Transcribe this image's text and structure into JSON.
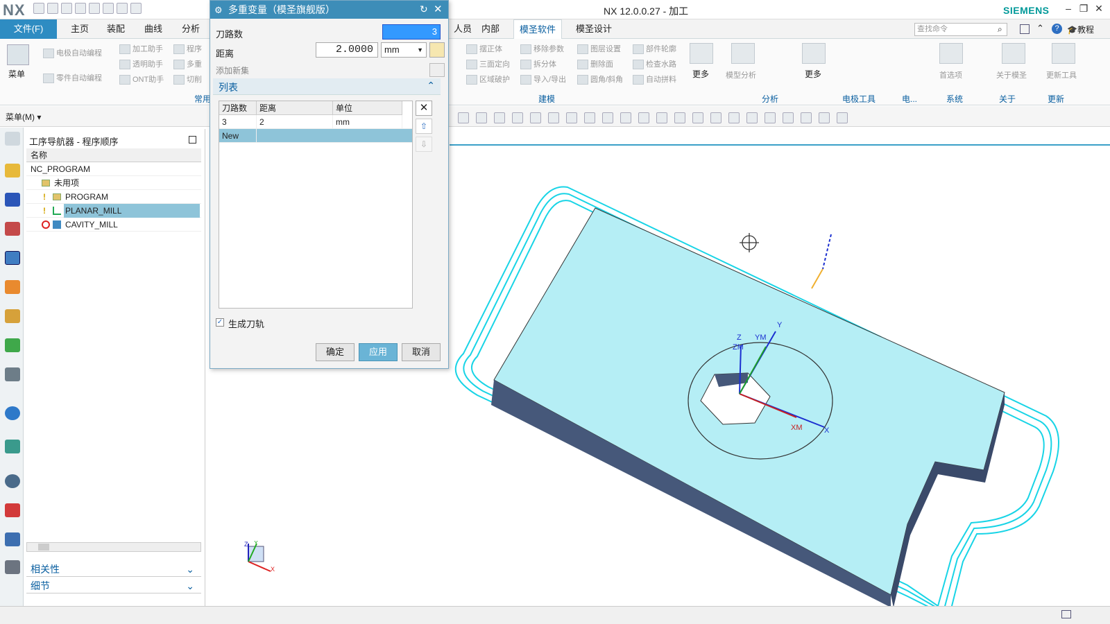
{
  "app": {
    "logo": "NX",
    "window_title": "NX 12.0.0.27 - 加工",
    "brand": "SIEMENS"
  },
  "ribbon": {
    "file_tab": "文件(F)",
    "tabs": [
      "主页",
      "装配",
      "曲线",
      "分析"
    ],
    "tabs_right": [
      "人员",
      "内部",
      "模圣软件",
      "模圣设计"
    ],
    "active_tab": "模圣软件",
    "search_placeholder": "查找命令",
    "tutorial": "教程",
    "menu_button": "菜单",
    "left_items": [
      "电极自动编程",
      "零件自动编程",
      "加工助手",
      "透明助手",
      "ONT助手",
      "程序",
      "多重",
      "切削"
    ],
    "group_common": "常用",
    "modeling_items": [
      "摆正体",
      "三面定向",
      "区域破护",
      "移除参数",
      "拆分体",
      "导入/导出",
      "图层设置",
      "删除面",
      "圆角/斜角",
      "部件轮廓",
      "检查水路",
      "自动拼料"
    ],
    "more": "更多",
    "groups": [
      "建模",
      "分析",
      "电极工具",
      "电...",
      "系统",
      "关于",
      "更新"
    ],
    "analysis_item": "模型分析",
    "system_item": "首选项",
    "about_item": "关于模圣",
    "update_item": "更新工具"
  },
  "toolbar2": {
    "menu_label": "菜单(M)"
  },
  "navigator": {
    "title": "工序导航器 - 程序顺序",
    "column_name": "名称",
    "rows": [
      {
        "label": "NC_PROGRAM",
        "indent": 0
      },
      {
        "label": "未用项",
        "indent": 1
      },
      {
        "label": "PROGRAM",
        "indent": 1
      },
      {
        "label": "PLANAR_MILL",
        "indent": 1
      },
      {
        "label": "CAVITY_MILL",
        "indent": 1
      }
    ],
    "selected": "PLANAR_MILL",
    "panels": [
      "相关性",
      "细节"
    ]
  },
  "dialog": {
    "title": "多重变量（模圣旗舰版）",
    "passes_label": "刀路数",
    "passes_value": "3",
    "distance_label": "距离",
    "distance_value": "2.0000",
    "unit_value": "mm",
    "add_set_label": "添加新集",
    "list_label": "列表",
    "table_headers": [
      "刀路数",
      "距离",
      "单位"
    ],
    "table_rows": [
      [
        "3",
        "2",
        "mm"
      ],
      [
        "New",
        "",
        ""
      ]
    ],
    "generate_label": "生成刀轨",
    "generate_checked": true,
    "ok": "确定",
    "apply": "应用",
    "cancel": "取消"
  },
  "viewport": {
    "axes": [
      "Z",
      "YM",
      "Y",
      "ZM",
      "XM",
      "X"
    ],
    "triad_axes": [
      "Z",
      "Y",
      "X"
    ]
  },
  "colors": {
    "accent": "#2e8cc2",
    "toolpath": "#18d4e6",
    "part_top": "#b5eef5",
    "part_side": "#46587a"
  }
}
